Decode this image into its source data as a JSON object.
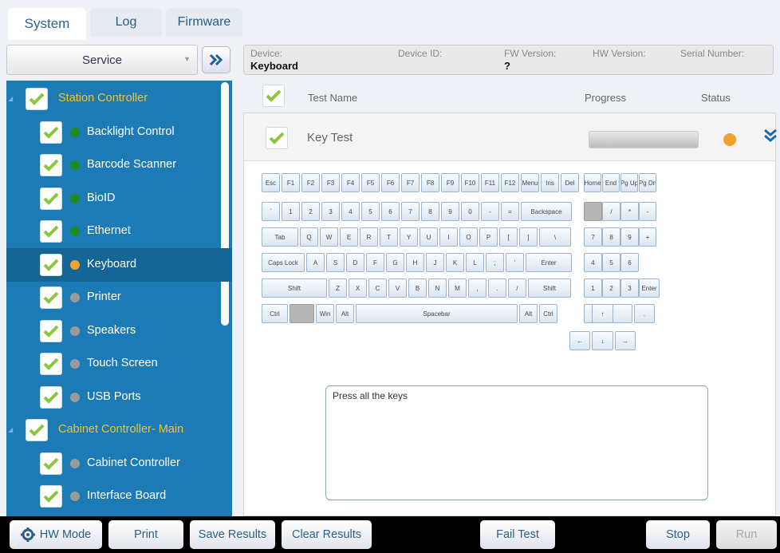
{
  "tabs": [
    {
      "label": "System"
    },
    {
      "label": "Log"
    },
    {
      "label": "Firmware"
    }
  ],
  "service": {
    "selected": "Service"
  },
  "tree": {
    "groups": [
      {
        "label": "Station Controller",
        "items": [
          {
            "label": "Backlight Control",
            "status": "green"
          },
          {
            "label": "Barcode Scanner",
            "status": "green"
          },
          {
            "label": "BioID",
            "status": "green"
          },
          {
            "label": "Ethernet",
            "status": "green"
          },
          {
            "label": "Keyboard",
            "status": "orange",
            "selected": true
          },
          {
            "label": "Printer",
            "status": "grey"
          },
          {
            "label": "Speakers",
            "status": "grey"
          },
          {
            "label": "Touch Screen",
            "status": "grey"
          },
          {
            "label": "USB Ports",
            "status": "grey"
          }
        ]
      },
      {
        "label": "Cabinet Controller- Main",
        "items": [
          {
            "label": "Cabinet Controller",
            "status": "grey"
          },
          {
            "label": "Interface Board",
            "status": "grey"
          }
        ]
      }
    ]
  },
  "device": {
    "device_label": "Device:",
    "device_value": "Keyboard",
    "id_label": "Device ID:",
    "fw_label": "FW Version:",
    "fw_value": "?",
    "hw_label": "HW Version:",
    "serial_label": "Serial Number:"
  },
  "table": {
    "col_name": "Test Name",
    "col_progress": "Progress",
    "col_status": "Status"
  },
  "test": {
    "name": "Key Test",
    "status_color": "#f0a132"
  },
  "keyboard": {
    "row1": [
      "Esc",
      "F1",
      "F2",
      "F3",
      "F4",
      "F5",
      "F6",
      "F7",
      "F8",
      "F9",
      "F10",
      "F11",
      "F12",
      "Menu",
      "Ins",
      "Del",
      "Home",
      "End",
      "Pg Up",
      "Pg Dn"
    ],
    "row2": [
      "`",
      "1",
      "2",
      "3",
      "4",
      "5",
      "6",
      "7",
      "8",
      "9",
      "0",
      "-",
      "=",
      "Backspace",
      "",
      "/",
      "*",
      "-"
    ],
    "row3": [
      "Tab",
      "Q",
      "W",
      "E",
      "R",
      "T",
      "Y",
      "U",
      "I",
      "O",
      "P",
      "[",
      "]",
      "\\",
      "7",
      "8",
      "9",
      "+"
    ],
    "row4": [
      "Caps Lock",
      "A",
      "S",
      "D",
      "F",
      "G",
      "H",
      "J",
      "K",
      "L",
      ";",
      "'",
      "Enter",
      "4",
      "5",
      "6"
    ],
    "row5": [
      "Shift",
      "Z",
      "X",
      "C",
      "V",
      "B",
      "N",
      "M",
      ",",
      ".",
      "/",
      "Shift",
      "1",
      "2",
      "3",
      "Enter"
    ],
    "row6": [
      "Ctrl",
      "",
      "Win",
      "Alt",
      "Spacebar",
      "Alt",
      "Ctrl",
      "0",
      "."
    ],
    "arrows": [
      "↑",
      "←",
      "↓",
      "→"
    ]
  },
  "output": {
    "text": "Press all the keys"
  },
  "bottom": {
    "hw_mode": "HW Mode",
    "print": "Print",
    "save": "Save Results",
    "clear": "Clear Results",
    "fail": "Fail Test",
    "stop": "Stop",
    "run": "Run"
  }
}
